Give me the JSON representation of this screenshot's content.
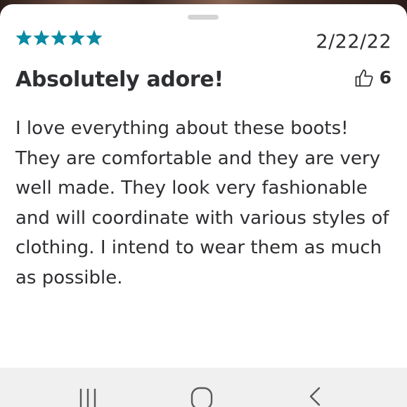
{
  "review": {
    "rating": 5,
    "rating_max": 5,
    "date": "2/22/22",
    "title": "Absolutely adore!",
    "helpful_count": "6",
    "body": "I love everything about these boots! They are comfortable and they are very well made. They look very fashionable and will coordinate with various styles of clothing. I intend to wear them as much as possible."
  },
  "icons": {
    "star": "star-icon",
    "thumb": "thumbs-up-icon",
    "nav_recent": "recent-apps-icon",
    "nav_home": "home-icon",
    "nav_back": "back-icon"
  },
  "colors": {
    "star": "#0a8aa3",
    "text": "#2e2f32",
    "sheet": "#ffffff",
    "navbar": "#f0f0f0",
    "handle": "#d4d4d4"
  }
}
